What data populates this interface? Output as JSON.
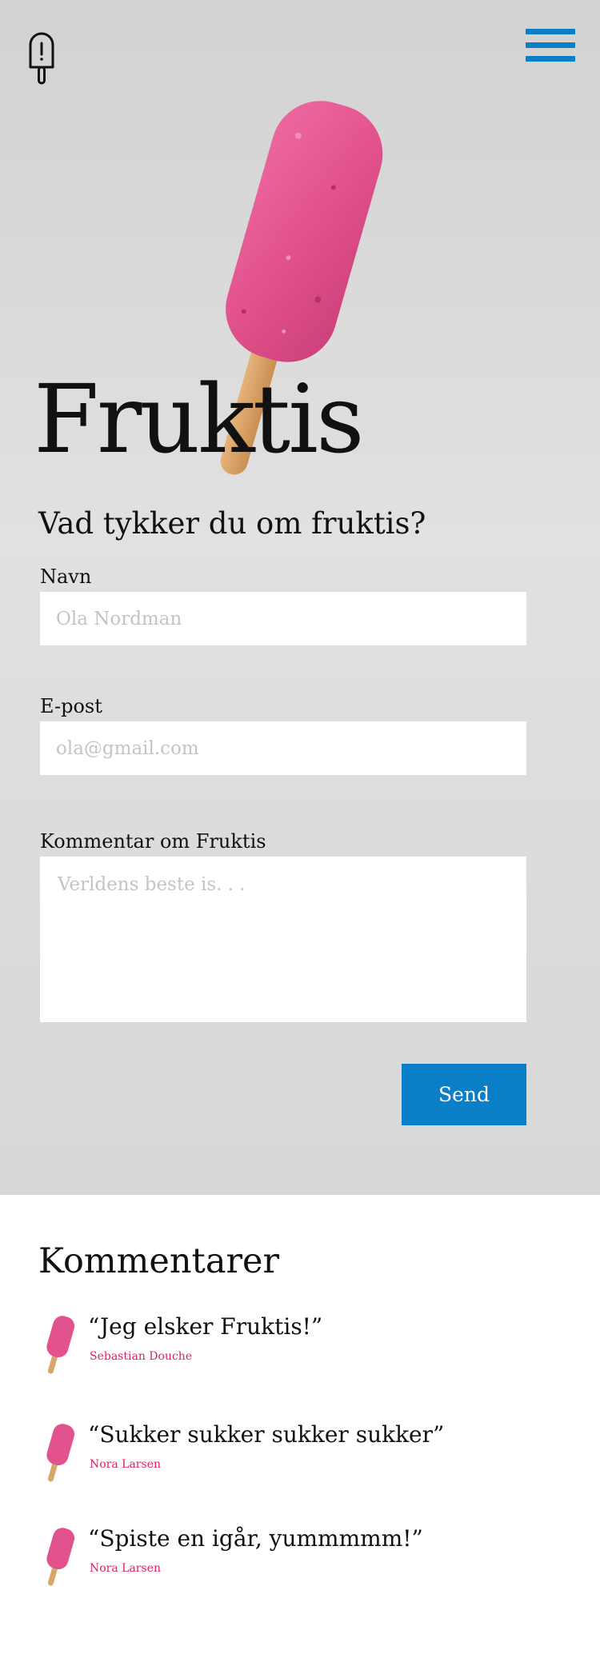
{
  "brand": {
    "logo_icon": "popsicle-outline-icon",
    "menu_icon": "hamburger-menu-icon",
    "accent_color": "#0a7ec6"
  },
  "hero": {
    "title": "Fruktis",
    "image_icon": "pink-popsicle-image"
  },
  "form": {
    "heading": "Vad tykker du om fruktis?",
    "name_label": "Navn",
    "name_placeholder": "Ola Nordman",
    "email_label": "E-post",
    "email_placeholder": "ola@gmail.com",
    "comment_label": "Kommentar om Fruktis",
    "comment_placeholder": "Verldens beste is. . .",
    "submit_label": "Send"
  },
  "comments": {
    "heading": "Kommentarer",
    "author_color": "#e0205f",
    "items": [
      {
        "quote": "“Jeg elsker Fruktis!”",
        "author": "Sebastian Douche"
      },
      {
        "quote": "“Sukker sukker sukker sukker”",
        "author": "Nora Larsen"
      },
      {
        "quote": "“Spiste en igår, yummmmm!”",
        "author": "Nora Larsen"
      }
    ]
  }
}
